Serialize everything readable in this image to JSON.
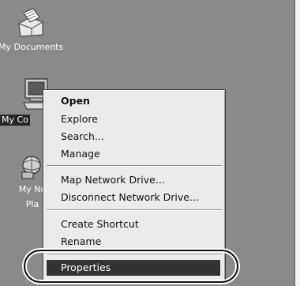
{
  "desktop": {
    "icons": [
      {
        "label": "My Documents",
        "icon": "folder-documents-icon"
      },
      {
        "label": "My Co",
        "icon": "computer-monitor-icon",
        "selected": true
      },
      {
        "label_line1": "My Ne",
        "label_line2": "Pla",
        "icon": "network-places-icon"
      }
    ]
  },
  "context_menu": {
    "items": [
      {
        "label": "Open",
        "bold": true
      },
      {
        "label": "Explore"
      },
      {
        "label": "Search..."
      },
      {
        "label": "Manage"
      },
      {
        "label": "Map Network Drive..."
      },
      {
        "label": "Disconnect Network Drive..."
      },
      {
        "label": "Create Shortcut"
      },
      {
        "label": "Rename"
      },
      {
        "label": "Properties",
        "highlighted": true
      }
    ]
  },
  "colors": {
    "desktop_background": "#8a8a8a",
    "menu_background": "#ebebeb",
    "highlight_background": "#333333",
    "callout": "#111111"
  }
}
